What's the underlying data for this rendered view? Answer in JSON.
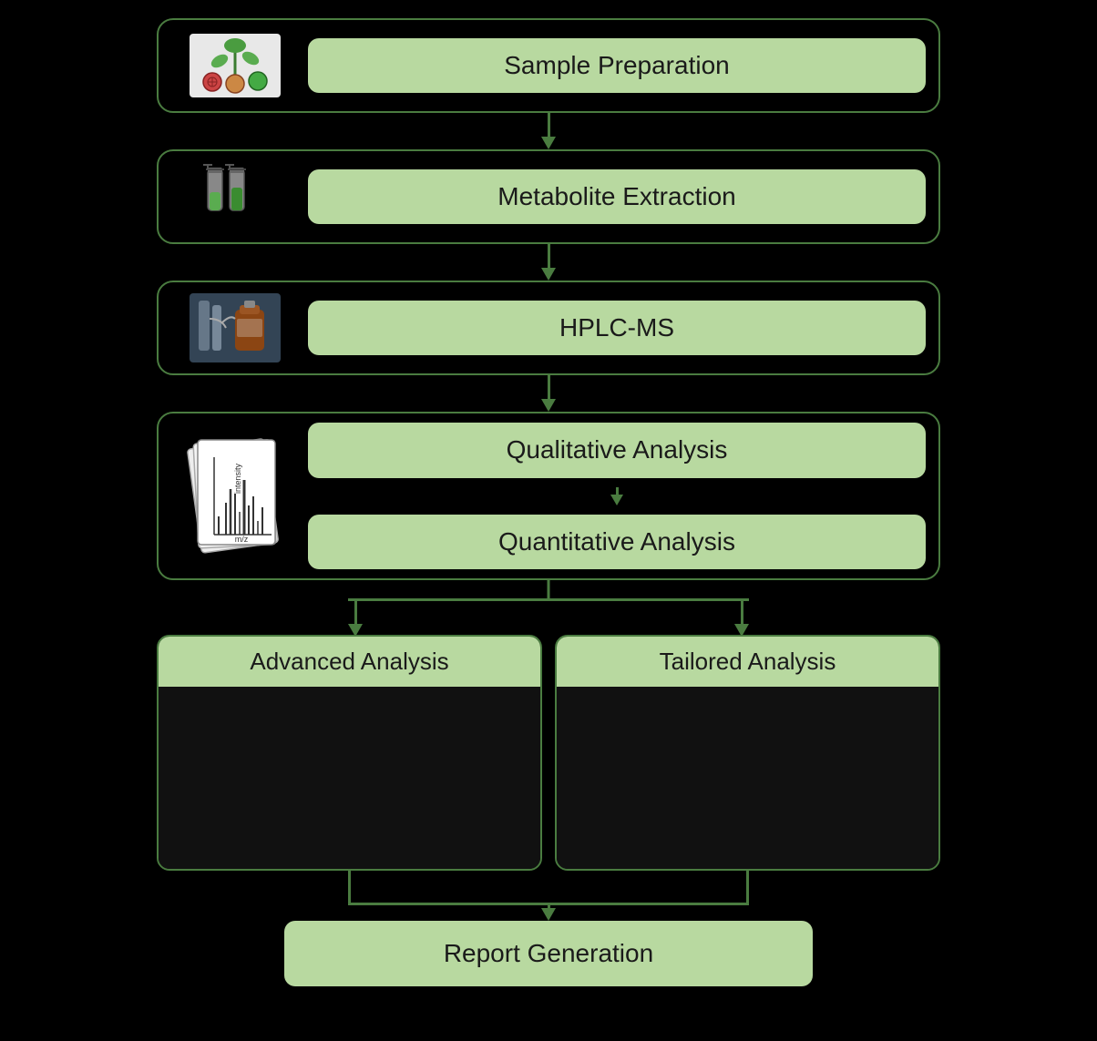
{
  "steps": {
    "sample_preparation": "Sample Preparation",
    "metabolite_extraction": "Metabolite Extraction",
    "hplc_ms": "HPLC-MS",
    "qualitative_analysis": "Qualitative Analysis",
    "quantitative_analysis": "Quantitative Analysis",
    "advanced_analysis": "Advanced Analysis",
    "tailored_analysis": "Tailored Analysis",
    "report_generation": "Report Generation"
  },
  "colors": {
    "bg": "#000000",
    "border": "#4a7c40",
    "box_fill": "#b8d9a0",
    "arrow": "#4a7c40"
  }
}
